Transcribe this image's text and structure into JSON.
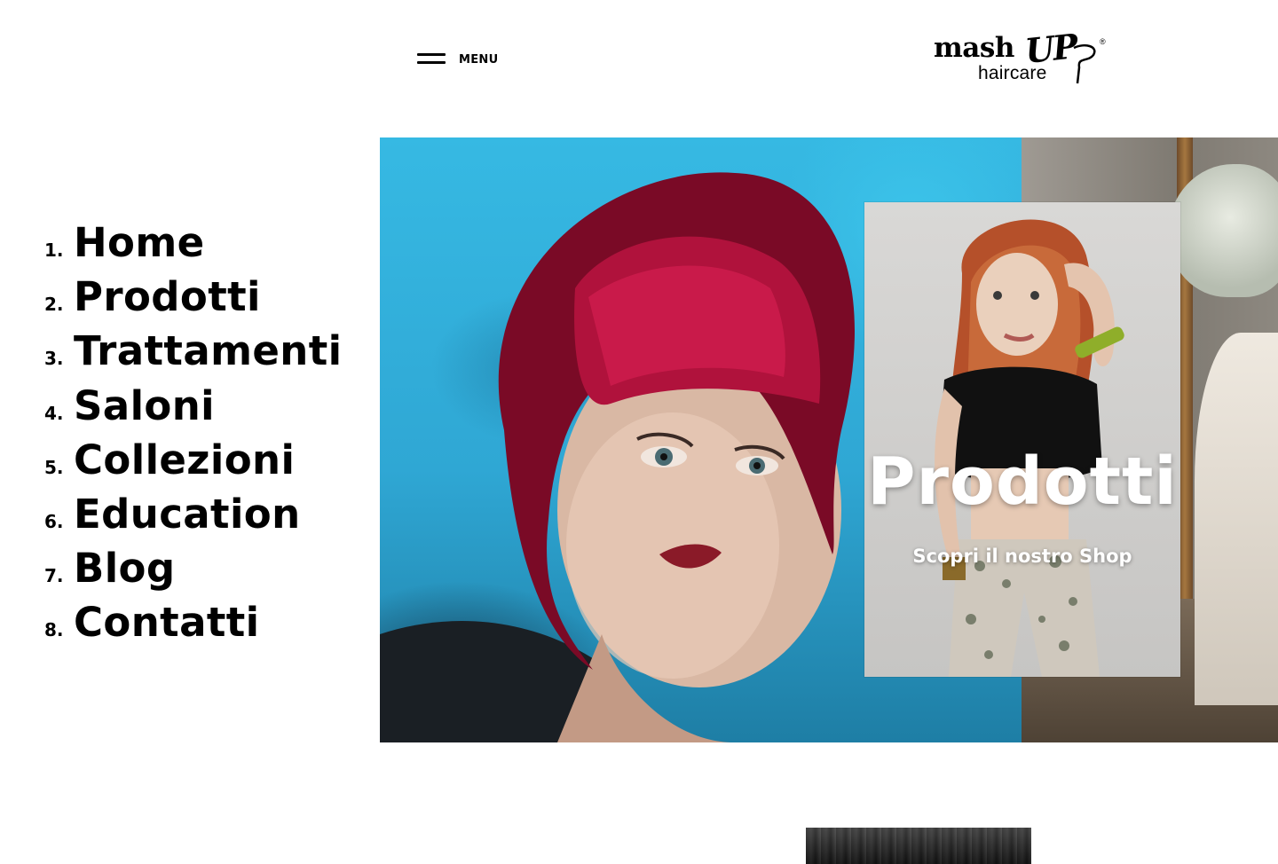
{
  "header": {
    "menu_label": "MENU",
    "logo": {
      "word1": "mash",
      "word2": "UP",
      "reg": "®",
      "word3": "haircare"
    }
  },
  "nav": {
    "items": [
      {
        "num": "1.",
        "label": "Home"
      },
      {
        "num": "2.",
        "label": "Prodotti"
      },
      {
        "num": "3.",
        "label": "Trattamenti"
      },
      {
        "num": "4.",
        "label": "Saloni"
      },
      {
        "num": "5.",
        "label": "Collezioni"
      },
      {
        "num": "6.",
        "label": "Education"
      },
      {
        "num": "7.",
        "label": "Blog"
      },
      {
        "num": "8.",
        "label": "Contatti"
      }
    ]
  },
  "hero": {
    "card_title": "Prodotti",
    "card_subtitle": "Scopri il nostro Shop"
  },
  "colors": {
    "hero_blue": "#36b9e3",
    "hair_red": "#b0123c",
    "text": "#000000",
    "background": "#ffffff"
  }
}
